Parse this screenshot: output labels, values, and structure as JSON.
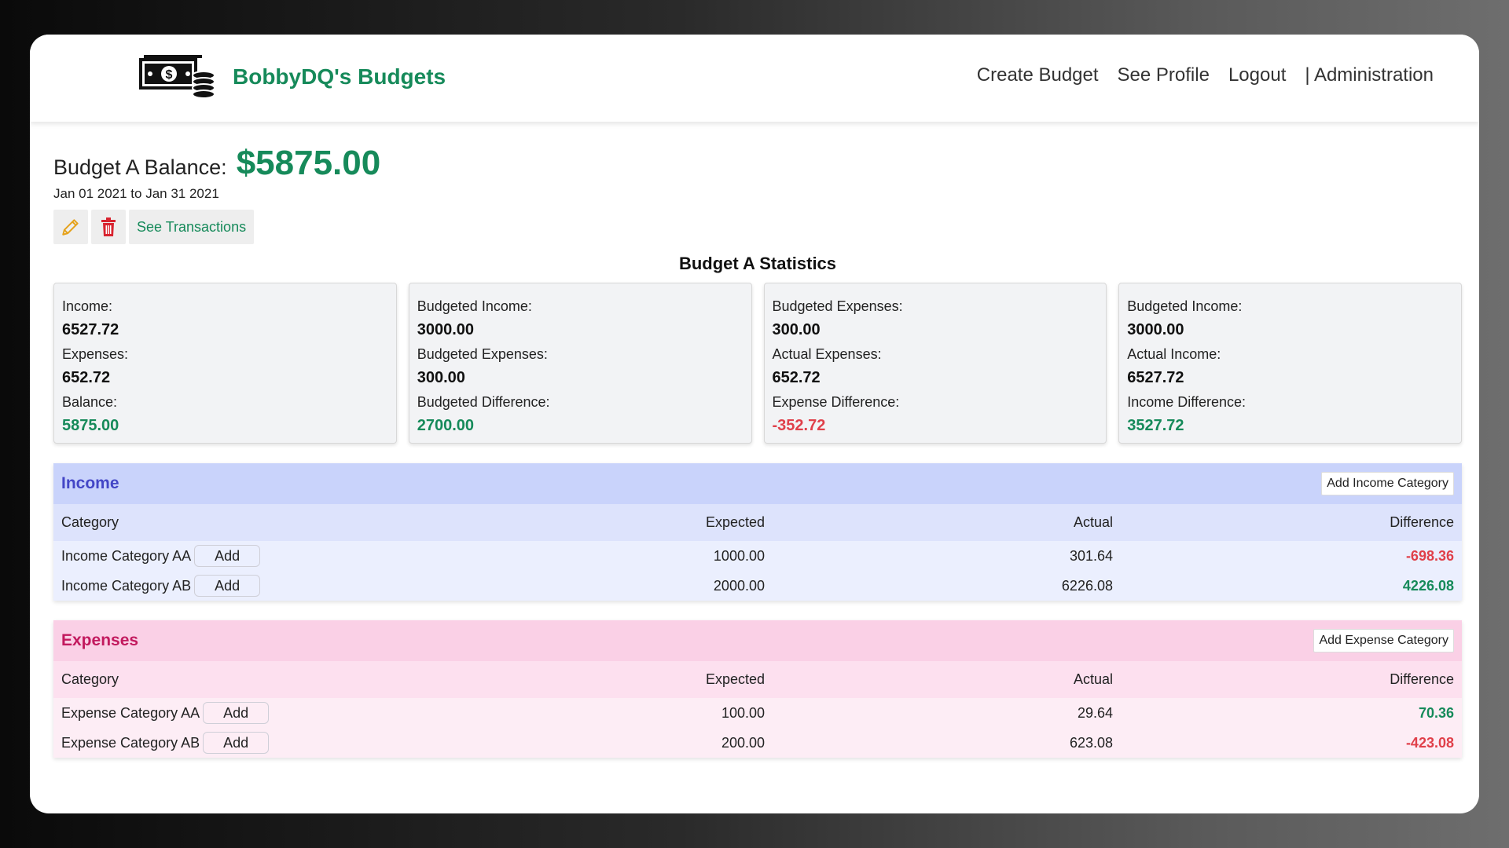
{
  "brand": {
    "name": "BobbyDQ's Budgets",
    "logo_icon": "money-bill-coins-icon"
  },
  "nav": {
    "create_budget": "Create Budget",
    "see_profile": "See Profile",
    "logout": "Logout",
    "administration": "| Administration"
  },
  "budget": {
    "balance_label": "Budget A Balance:",
    "balance_value": "$5875.00",
    "date_range": "Jan 01 2021 to Jan 31 2021",
    "edit_icon": "pencil-icon",
    "delete_icon": "trash-icon",
    "see_transactions": "See Transactions"
  },
  "stats": {
    "title": "Budget A Statistics",
    "cards": [
      {
        "l1": "Income:",
        "v1": "6527.72",
        "l2": "Expenses:",
        "v2": "652.72",
        "l3": "Balance:",
        "v3": "5875.00"
      },
      {
        "l1": "Budgeted Income:",
        "v1": "3000.00",
        "l2": "Budgeted Expenses:",
        "v2": "300.00",
        "l3": "Budgeted Difference:",
        "v3": "2700.00"
      },
      {
        "l1": "Budgeted Expenses:",
        "v1": "300.00",
        "l2": "Actual Expenses:",
        "v2": "652.72",
        "l3": "Expense Difference:",
        "v3": "-352.72"
      },
      {
        "l1": "Budgeted Income:",
        "v1": "3000.00",
        "l2": "Actual Income:",
        "v2": "6527.72",
        "l3": "Income Difference:",
        "v3": "3527.72"
      }
    ]
  },
  "income": {
    "title": "Income",
    "add_category": "Add Income Category",
    "headers": {
      "category": "Category",
      "expected": "Expected",
      "actual": "Actual",
      "difference": "Difference"
    },
    "add_label": "Add",
    "rows": [
      {
        "category": "Income Category AA",
        "expected": "1000.00",
        "actual": "301.64",
        "difference": "-698.36"
      },
      {
        "category": "Income Category AB",
        "expected": "2000.00",
        "actual": "6226.08",
        "difference": "4226.08"
      }
    ]
  },
  "expenses": {
    "title": "Expenses",
    "add_category": "Add Expense Category",
    "headers": {
      "category": "Category",
      "expected": "Expected",
      "actual": "Actual",
      "difference": "Difference"
    },
    "add_label": "Add",
    "rows": [
      {
        "category": "Expense Category AA",
        "expected": "100.00",
        "actual": "29.64",
        "difference": "70.36"
      },
      {
        "category": "Expense Category AB",
        "expected": "200.00",
        "actual": "623.08",
        "difference": "-423.08"
      }
    ]
  },
  "colors": {
    "brand_green": "#168a5a",
    "negative_red": "#e0404a",
    "income_blue": "#4346c6",
    "expense_pink": "#c2195e"
  }
}
